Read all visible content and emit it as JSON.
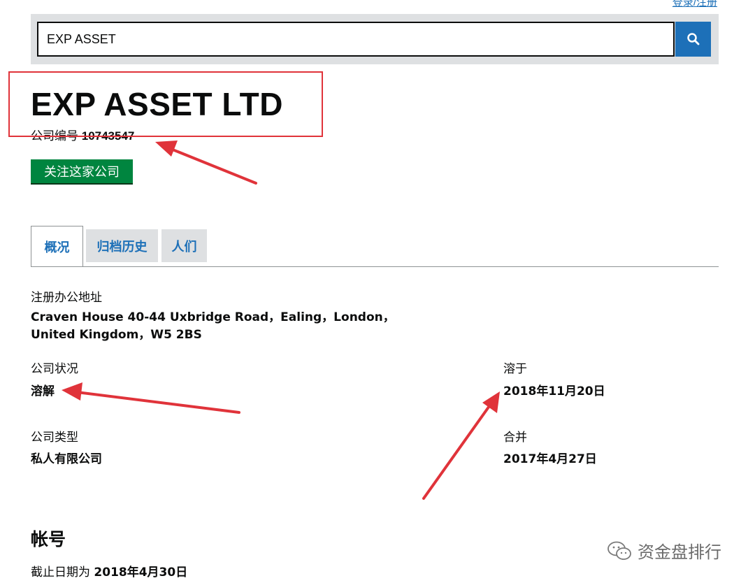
{
  "header": {
    "top_link": "登录/注册"
  },
  "search": {
    "value": "EXP ASSET",
    "icon": "search-icon"
  },
  "company": {
    "name": "EXP ASSET LTD",
    "number_label": "公司编号",
    "number": "10743547",
    "follow_label": "关注这家公司"
  },
  "tabs": [
    {
      "label": "概况",
      "active": true
    },
    {
      "label": "归档历史",
      "active": false
    },
    {
      "label": "人们",
      "active": false
    }
  ],
  "overview": {
    "address_label": "注册办公地址",
    "address": "Craven House 40-44 Uxbridge Road，Ealing，London，United Kingdom，W5 2BS",
    "status_label": "公司状况",
    "status": "溶解",
    "dissolved_label": "溶于",
    "dissolved_date": "2018年11月20日",
    "type_label": "公司类型",
    "type": "私人有限公司",
    "incorporated_label": "合并",
    "incorporated_date": "2017年4月27日"
  },
  "accounts": {
    "title": "帐号",
    "due_prefix": "截止日期为",
    "due_date": "2018年4月30日"
  },
  "watermark": {
    "text": "资金盘排行",
    "icon": "wechat-icon"
  },
  "annotation_color": "#e0333a"
}
